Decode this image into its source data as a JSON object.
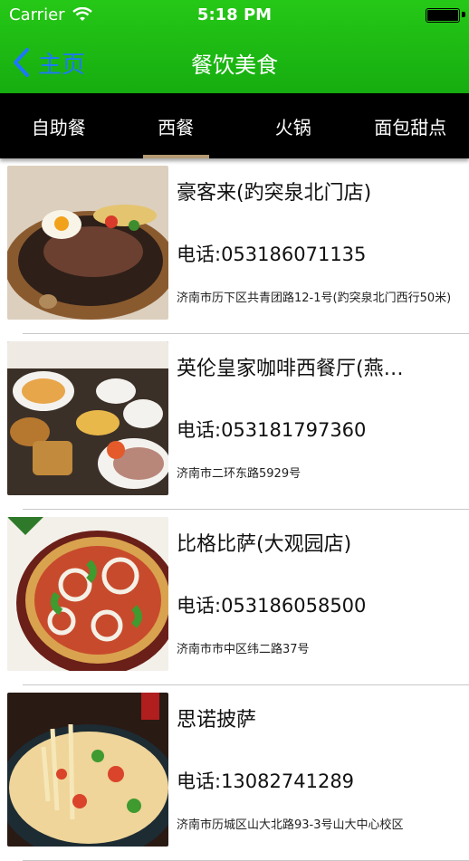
{
  "status_bar": {
    "carrier": "Carrier",
    "time": "5:18 PM"
  },
  "nav": {
    "back_label": "主页",
    "title": "餐饮美食"
  },
  "tabs": [
    {
      "label": "自助餐"
    },
    {
      "label": "西餐",
      "active": true
    },
    {
      "label": "火锅"
    },
    {
      "label": "面包甜点"
    }
  ],
  "restaurants": [
    {
      "name": "豪客来(趵突泉北门店)",
      "phone": "电话:053186071135",
      "address": "济南市历下区共青团路12-1号(趵突泉北门西行50米)"
    },
    {
      "name": "英伦皇家咖啡西餐厅(燕…",
      "phone": "电话:053181797360",
      "address": "济南市二环东路5929号"
    },
    {
      "name": "比格比萨(大观园店)",
      "phone": "电话:053186058500",
      "address": "济南市市中区纬二路37号"
    },
    {
      "name": "思诺披萨",
      "phone": "电话:13082741289",
      "address": "济南市历城区山大北路93-3号山大中心校区"
    }
  ],
  "colors": {
    "header_green": "#1fbb13",
    "back_blue": "#1e77ff",
    "tab_underline": "#b59a73"
  }
}
